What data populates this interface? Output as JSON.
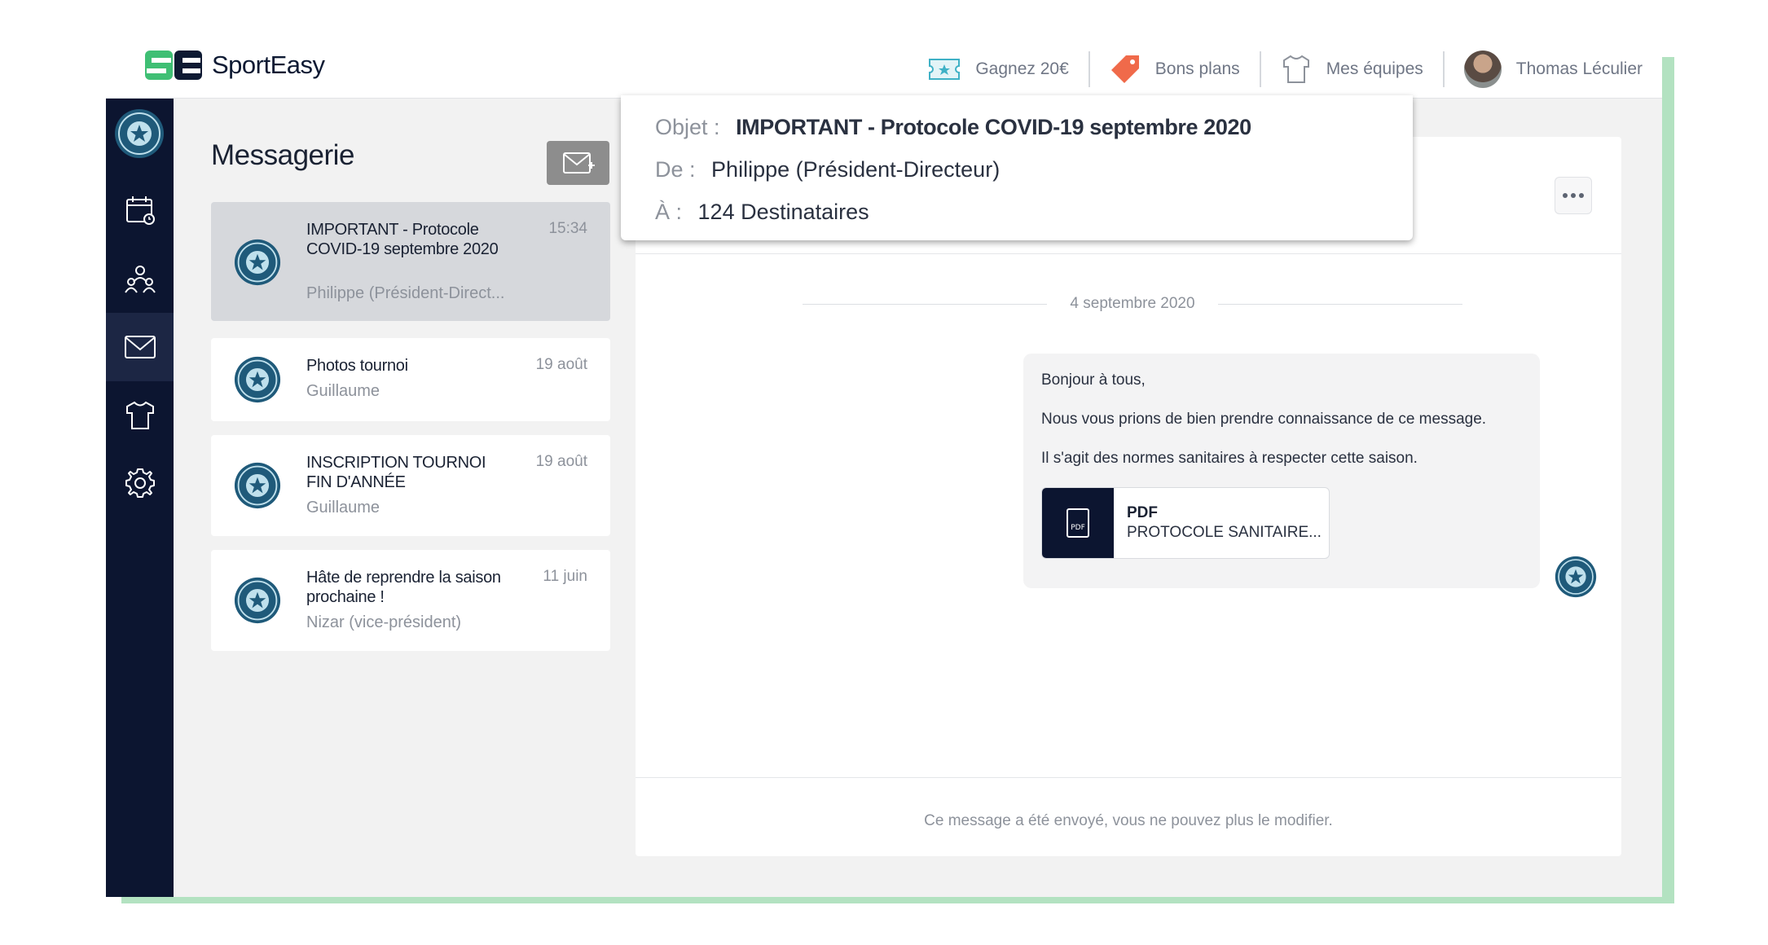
{
  "app": {
    "brand": "SportEasy",
    "colors": {
      "accent_green": "#3fbf74",
      "navy": "#0c1530",
      "frame_green": "#b3e2c1"
    }
  },
  "topnav": {
    "referral": {
      "label": "Gagnez 20€",
      "icon": "ticket-icon"
    },
    "deals": {
      "label": "Bons plans",
      "icon": "tag-icon"
    },
    "teams": {
      "label": "Mes équipes",
      "icon": "shirt-icon"
    },
    "user": {
      "name": "Thomas Léculier",
      "icon": "avatar"
    }
  },
  "rail": {
    "items": [
      {
        "name": "calendar",
        "icon": "calendar-icon"
      },
      {
        "name": "members",
        "icon": "people-icon"
      },
      {
        "name": "messages",
        "icon": "mail-icon",
        "active": true
      },
      {
        "name": "shop",
        "icon": "shirt-icon"
      },
      {
        "name": "settings",
        "icon": "gear-icon"
      }
    ]
  },
  "messagerie": {
    "title": "Messagerie",
    "conversations": [
      {
        "subject": "IMPORTANT - Protocole COVID-19 septembre 2020",
        "sender": "Philippe (Président-Direct...",
        "time": "15:34",
        "selected": true
      },
      {
        "subject": "Photos tournoi",
        "sender": "Guillaume",
        "time": "19 août"
      },
      {
        "subject": "INSCRIPTION TOURNOI FIN D'ANNÉE",
        "sender": "Guillaume",
        "time": "19 août"
      },
      {
        "subject": "Hâte de reprendre la saison prochaine !",
        "sender": "Nizar (vice-président)",
        "time": "11 juin"
      }
    ]
  },
  "detail": {
    "header": {
      "subject_label": "Objet :",
      "subject": "IMPORTANT - Protocole COVID-19 septembre 2020",
      "from_label": "De :",
      "from": "Philippe (Président-Directeur)",
      "to_label": "À :",
      "to": "124 Destinataires"
    },
    "date": "4 septembre 2020",
    "message": {
      "lines": [
        "Bonjour à tous,",
        "Nous vous prions de bien prendre connaissance de ce message.",
        "Il s'agit des normes sanitaires à respecter cette saison."
      ],
      "attachment": {
        "type": "PDF",
        "name": "PROTOCOLE SANITAIRE...",
        "icon_text": "PDF"
      }
    },
    "footer": "Ce message a été envoyé, vous ne pouvez plus le modifier."
  }
}
